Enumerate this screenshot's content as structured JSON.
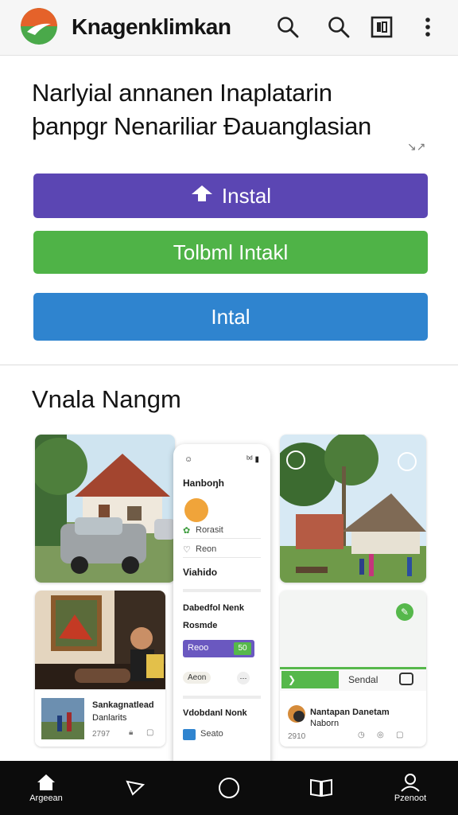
{
  "app": {
    "title": "Knagenklimkan"
  },
  "hero": {
    "headline_line1": "Narlyial annanen Inaplatarin",
    "headline_line2": "þanpgr Nenariliar Ðauanglasian",
    "sparkle": "↘↗"
  },
  "buttons": {
    "install_primary": "Instal",
    "install_secondary": "Tolbml Intakl",
    "install_tertiary": "Intal"
  },
  "section": {
    "title": "Vnala Nangm"
  },
  "phone_overlay": {
    "time": "☺",
    "signal": "ᵇᵈ ▮",
    "heading": "Hanboŋh",
    "item_1": "Rorasit",
    "item_2": "Reon",
    "section_2": "Viahido",
    "section_3_line1": "Dabedfol Nenk",
    "section_3_line2": "Rosmde",
    "chip_label": "Reoo",
    "chip_value": "50",
    "pill": "Aeon",
    "section_4": "Vdobdanl Nonk",
    "item_5": "Seato"
  },
  "cards": {
    "lower_left_title": "Sankagnatlead",
    "lower_left_sub": "Danlarits",
    "lower_left_meta": "2797",
    "lower_right_button": "Sendal",
    "lower_right_title": "Nantapan Danetam",
    "lower_right_sub": "Naborn",
    "lower_right_meta": "2910"
  },
  "bottom_nav": {
    "home": "Argeean",
    "profile": "Pzenoot"
  },
  "colors": {
    "purple": "#5b46b3",
    "green": "#4fb347",
    "blue": "#2f84cf",
    "nav_bg": "#0c0c0c"
  }
}
